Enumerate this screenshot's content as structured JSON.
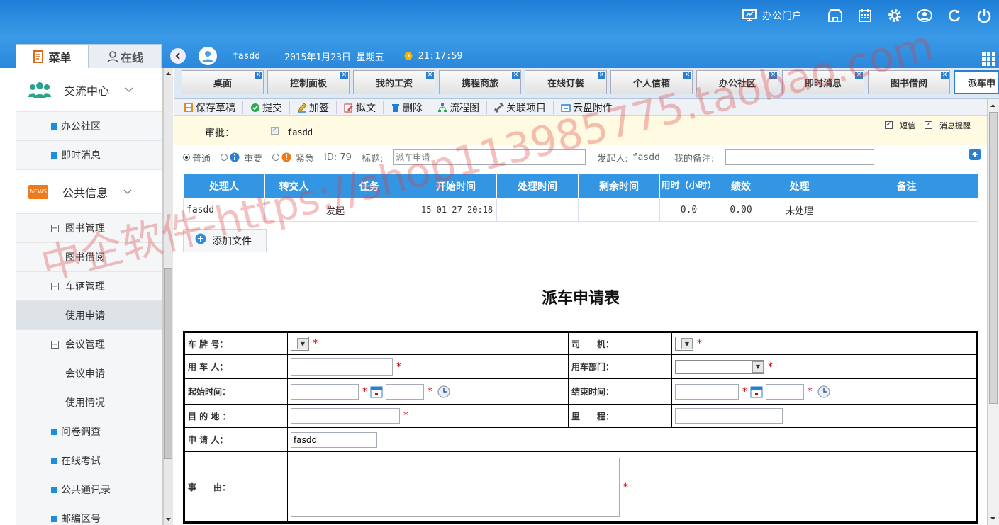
{
  "header": {
    "portal_label": "办公门户",
    "icons": [
      "portal-icon",
      "store-icon",
      "calendar-icon",
      "gear-icon",
      "user-icon",
      "refresh-icon",
      "power-icon"
    ]
  },
  "left_tabs": {
    "menu": "菜单",
    "online": "在线"
  },
  "userbar": {
    "username": "fasdd",
    "date": "2015年1月23日 星期五",
    "time": "21:17:59"
  },
  "sidebar": {
    "group1": "交流中心",
    "items1": [
      "办公社区",
      "即时消息"
    ],
    "group2": "公共信息",
    "news_badge": "NEWS",
    "sub1": "图书管理",
    "sub1_items": [
      "图书借阅"
    ],
    "sub2": "车辆管理",
    "sub2_items": [
      "使用申请"
    ],
    "sub3": "会议管理",
    "sub3_items": [
      "会议申请",
      "使用情况"
    ],
    "items2": [
      "问卷调查",
      "在线考试",
      "公共通讯录",
      "邮编区号"
    ]
  },
  "page_tabs": [
    "桌面",
    "控制面板",
    "我的工资",
    "携程商旅",
    "在线订餐",
    "个人信箱",
    "办公社区",
    "即时消息",
    "图书借阅",
    "派车申"
  ],
  "toolbar": [
    "保存草稿",
    "提交",
    "加签",
    "拟文",
    "删除",
    "流程图",
    "关联项目",
    "云盘附件"
  ],
  "approve": {
    "label": "审批：",
    "user": "fasdd",
    "sms": "短信",
    "remind": "消息提醒"
  },
  "priority": {
    "normal": "普通",
    "important": "重要",
    "urgent": "紧急",
    "id_label": "ID: 79",
    "title_label": "标题:",
    "title_value": "派车申请",
    "initiator_label": "发起人:",
    "initiator": "fasdd",
    "remark_label": "我的备注:"
  },
  "task_table": {
    "headers": [
      "处理人",
      "转交人",
      "任务",
      "开始时间",
      "处理时间",
      "剩余时间",
      "用时（小时）",
      "绩效",
      "处理",
      "备注"
    ],
    "row": [
      "fasdd",
      "",
      "发起",
      "15-01-27 20:18",
      "",
      "",
      "0.0",
      "0.00",
      "未处理",
      ""
    ]
  },
  "add_file": "添加文件",
  "form": {
    "title": "派车申请表",
    "plate": "车 牌 号：",
    "driver": "司　　机：",
    "user": "用 车 人：",
    "dept": "用车部门：",
    "start": "起始时间：",
    "end": "结束时间：",
    "dest": "目 的 地 ：",
    "mileage": "里　　程：",
    "applicant": "申 请 人：",
    "applicant_value": "fasdd",
    "reason": "事　　由："
  },
  "watermark": "中企软件-https://shop113985775.taobao.com"
}
